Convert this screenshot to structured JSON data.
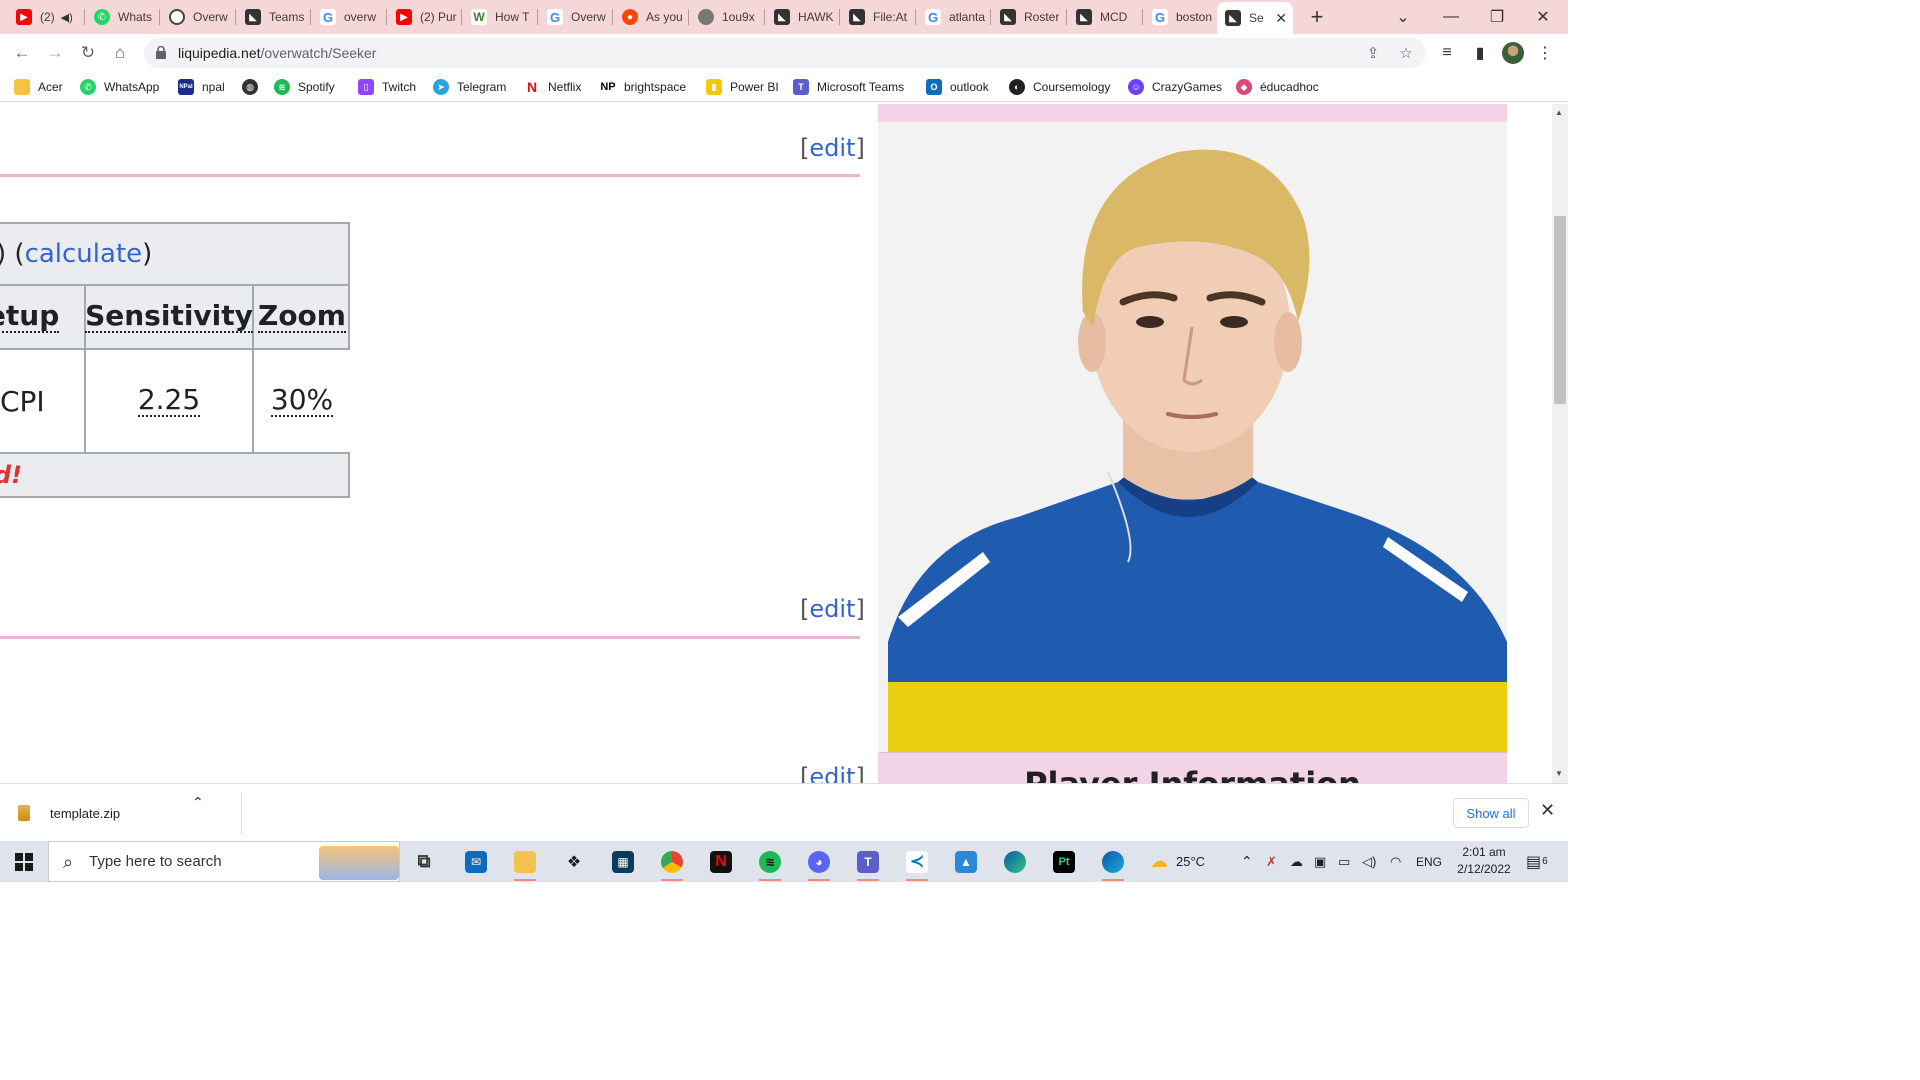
{
  "tabs": [
    {
      "label": "(2)",
      "icon": "youtube-icon",
      "color": "#ff0000"
    },
    {
      "label": "Whats",
      "icon": "whatsapp-icon",
      "color": "#25d366"
    },
    {
      "label": "Overw",
      "icon": "overwatch-icon",
      "color": "#444444"
    },
    {
      "label": "Teams",
      "icon": "liquipedia-icon",
      "color": "#333333"
    },
    {
      "label": "overw",
      "icon": "google-icon",
      "color": "#4285f4"
    },
    {
      "label": "(2) Pur",
      "icon": "youtube-icon",
      "color": "#ff0000"
    },
    {
      "label": "How T",
      "icon": "wikihow-icon",
      "color": "#93b874"
    },
    {
      "label": "Overw",
      "icon": "google-icon",
      "color": "#4285f4"
    },
    {
      "label": "As you",
      "icon": "reddit-icon",
      "color": "#ff4500"
    },
    {
      "label": "1ou9x",
      "icon": "globe-icon",
      "color": "#777777"
    },
    {
      "label": "HAWK",
      "icon": "liquipedia-icon",
      "color": "#333333"
    },
    {
      "label": "File:At",
      "icon": "liquipedia-icon",
      "color": "#333333"
    },
    {
      "label": "atlanta",
      "icon": "google-icon",
      "color": "#4285f4"
    },
    {
      "label": "Roster",
      "icon": "liquipedia-icon",
      "color": "#333333"
    },
    {
      "label": "MCD",
      "icon": "liquipedia-icon",
      "color": "#333333"
    },
    {
      "label": "boston",
      "icon": "google-icon",
      "color": "#4285f4"
    },
    {
      "label": "Se",
      "icon": "liquipedia-icon",
      "color": "#333333"
    }
  ],
  "address": {
    "domain": "liquipedia.net",
    "path": "/overwatch/Seeker"
  },
  "bookmarks": [
    {
      "label": "Acer",
      "icon": "folder-icon",
      "color": "#f5c242"
    },
    {
      "label": "WhatsApp",
      "icon": "whatsapp-icon",
      "color": "#25d366"
    },
    {
      "label": "npal",
      "icon": "npal-icon",
      "color": "#1a2b8c"
    },
    {
      "label": "",
      "icon": "globe-icon",
      "color": "#333333"
    },
    {
      "label": "Spotify",
      "icon": "spotify-icon",
      "color": "#1db954"
    },
    {
      "label": "Twitch",
      "icon": "twitch-icon",
      "color": "#9146ff"
    },
    {
      "label": "Telegram",
      "icon": "telegram-icon",
      "color": "#2aa3e0"
    },
    {
      "label": "Netflix",
      "icon": "netflix-icon",
      "color": "#e50914"
    },
    {
      "label": "brightspace",
      "icon": "np-icon",
      "color": "#000000"
    },
    {
      "label": "Power BI",
      "icon": "powerbi-icon",
      "color": "#f2c811"
    },
    {
      "label": "Microsoft Teams",
      "icon": "teams-icon",
      "color": "#5b5fc7"
    },
    {
      "label": "outlook",
      "icon": "outlook-icon",
      "color": "#0f6cbd"
    },
    {
      "label": "Coursemology",
      "icon": "coursemology-icon",
      "color": "#222222"
    },
    {
      "label": "CrazyGames",
      "icon": "crazygames-icon",
      "color": "#6842ff"
    },
    {
      "label": "éducadhoc",
      "icon": "educadhoc-icon",
      "color": "#e0457b"
    }
  ],
  "page": {
    "edit_label": "edit",
    "table": {
      "caption_prefix": ") (",
      "caption_link": "calculate",
      "caption_suffix": ")",
      "headers": [
        "Setup",
        "Sensitivity",
        "Zoom"
      ],
      "values": [
        "CPI",
        "2.25",
        "30%"
      ],
      "footer": "d!"
    },
    "infobox_title": "Player Information"
  },
  "downloads": {
    "file": "template.zip",
    "show_all": "Show all"
  },
  "taskbar": {
    "search_placeholder": "Type here to search",
    "weather": "25°C",
    "language": "ENG",
    "time": "2:01 am",
    "date": "2/12/2022",
    "notification_count": "6"
  },
  "colors": {
    "accent_pink": "#e6b7d4",
    "link_blue": "#3366cc",
    "tab_strip": "#f6d7d7",
    "alert_red": "#d33"
  }
}
